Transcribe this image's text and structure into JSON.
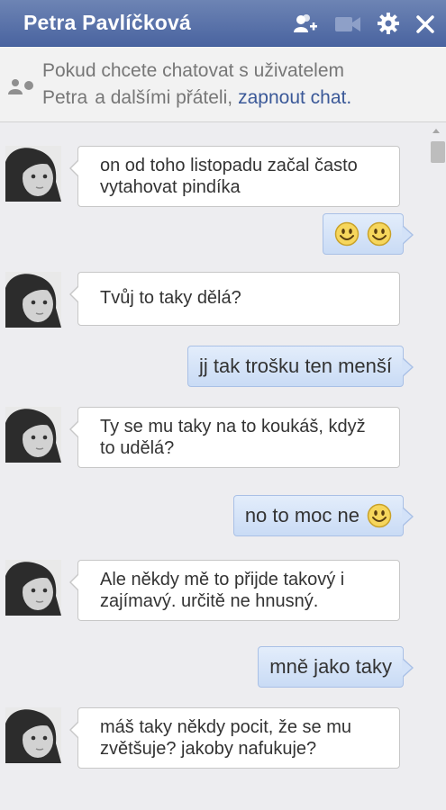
{
  "header": {
    "title": "Petra Pavlíčková",
    "icons": [
      "add-friend-icon",
      "video-call-icon",
      "gear-icon",
      "close-icon"
    ]
  },
  "notice": {
    "line1": "Pokud chcete chatovat s uživatelem",
    "name": "Petra",
    "line2": "a dalšími přáteli,",
    "link": "zapnout chat."
  },
  "messages": [
    {
      "from": "contact",
      "text": "on od toho listopadu začal často vytahovat pindíka"
    },
    {
      "from": "me",
      "text": "",
      "emoji": [
        "smiley",
        "smiley"
      ]
    },
    {
      "from": "contact",
      "text": "Tvůj to taky dělá?"
    },
    {
      "from": "me",
      "text": "jj tak trošku ten menší"
    },
    {
      "from": "contact",
      "text": "Ty se mu taky na to koukáš, když to udělá?"
    },
    {
      "from": "me",
      "text": "no to moc ne",
      "emoji": [
        "smiley"
      ]
    },
    {
      "from": "contact",
      "text": "Ale někdy mě to přijde takový i zajímavý. určitě ne hnusný."
    },
    {
      "from": "me",
      "text": "mně jako taky"
    },
    {
      "from": "contact",
      "text": "máš taky někdy pocit, že se mu zvětšuje? jakoby nafukuje?"
    }
  ],
  "colors": {
    "header": "#4a64a0",
    "link": "#3b5998",
    "outgoing_bubble": "#d3e2f8",
    "incoming_bubble": "#ffffff"
  }
}
